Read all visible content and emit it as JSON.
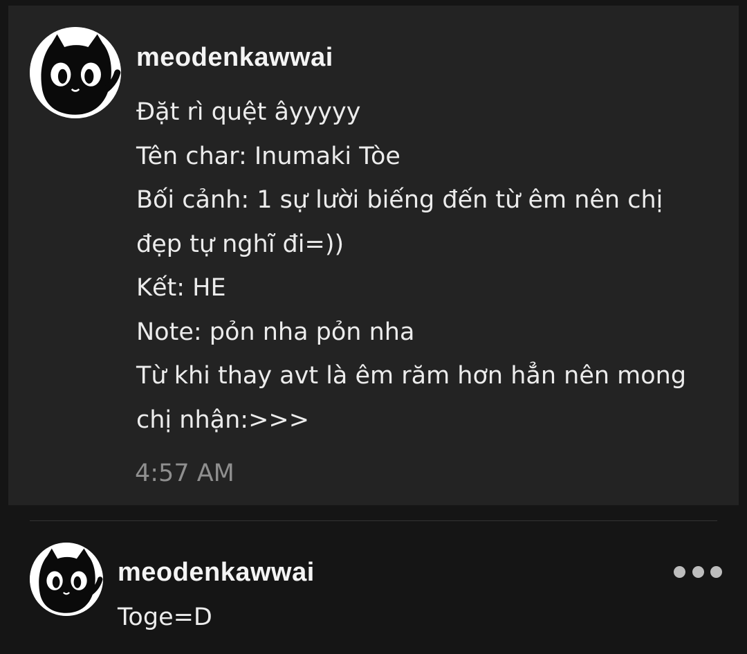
{
  "messages": [
    {
      "username": "meodenkawwai",
      "lines": [
        "Đặt rì quệt âyyyyy",
        "Tên char: Inumaki Tòe",
        "Bối cảnh: 1 sự lười biếng đến từ êm nên chị",
        "đẹp tự nghĩ đi=))",
        "Kết: HE",
        "Note: pỏn nha pỏn nha",
        "Từ khi thay avt là êm răm hơn hẳn nên mong",
        "chị nhận:>>>"
      ],
      "time": "4:57 AM"
    },
    {
      "username": "meodenkawwai",
      "text": "Toge=D"
    }
  ],
  "icons": {
    "avatar": "black-cat-avatar",
    "more": "more-options-icon"
  },
  "colors": {
    "background": "#151515",
    "card": "#232323",
    "text": "#ececec",
    "timestamp": "#8f8f8f"
  }
}
